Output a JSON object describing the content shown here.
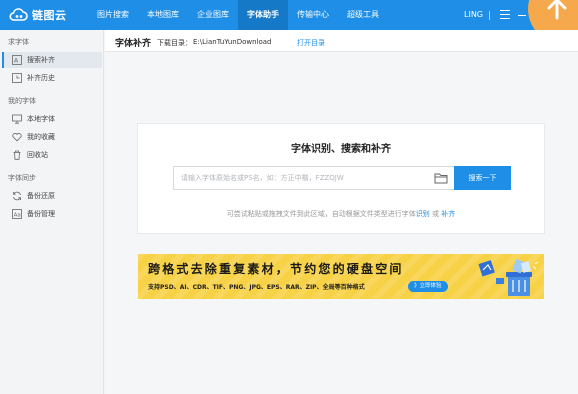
{
  "app": {
    "name": "链图云",
    "user": "LING"
  },
  "nav": {
    "items": [
      {
        "label": "图片搜索",
        "active": false
      },
      {
        "label": "本地图库",
        "active": false
      },
      {
        "label": "企业图库",
        "active": false
      },
      {
        "label": "字体助手",
        "active": true
      },
      {
        "label": "传输中心",
        "active": false
      },
      {
        "label": "超级工具",
        "active": false
      }
    ]
  },
  "sidebar": {
    "sections": [
      {
        "title": "求字体",
        "items": [
          {
            "label": "搜索补齐",
            "icon": "font-search-icon",
            "active": true
          },
          {
            "label": "补齐历史",
            "icon": "history-icon",
            "active": false
          }
        ]
      },
      {
        "title": "我的字体",
        "items": [
          {
            "label": "本地字体",
            "icon": "monitor-icon",
            "active": false
          },
          {
            "label": "我的收藏",
            "icon": "heart-icon",
            "active": false
          },
          {
            "label": "回收站",
            "icon": "trash-icon",
            "active": false
          }
        ]
      },
      {
        "title": "字体同步",
        "items": [
          {
            "label": "备份还原",
            "icon": "sync-icon",
            "active": false
          },
          {
            "label": "备份管理",
            "icon": "font-manage-icon",
            "active": false
          }
        ]
      }
    ]
  },
  "header": {
    "title": "字体补齐",
    "download_label": "下载目录：",
    "download_path": "E:\\LianTuYunDownload",
    "open_dir_label": "打开目录"
  },
  "search": {
    "title": "字体识别、搜索和补齐",
    "placeholder": "请输入字体原始名或PS名，如：方正中楷，FZZQJW",
    "value": "",
    "button_label": "搜索一下",
    "hint_prefix": "可尝试粘贴或拖拽文件到此区域，自动根据文件类型进行字体",
    "hint_link1": "识别",
    "hint_mid": "或",
    "hint_link2": "补齐"
  },
  "banner": {
    "headline": "跨格式去除重复素材，节约您的硬盘空间",
    "subline": "支持PSD、AI、CDR、TIF、PNG、JPG、EPS、RAR、ZIP、全局等百种格式",
    "button_label": "》立即体验"
  },
  "colors": {
    "accent": "#1e8ee6",
    "banner_bg": "#f8d246",
    "corner": "#f5a84c"
  }
}
